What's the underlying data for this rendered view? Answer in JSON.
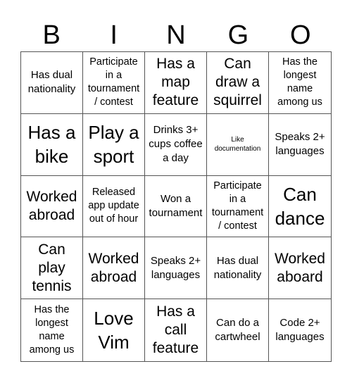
{
  "header": {
    "letters": [
      "B",
      "I",
      "N",
      "G",
      "O"
    ]
  },
  "board": {
    "cells": [
      {
        "text": "Has dual nationality",
        "size": "m"
      },
      {
        "text": "Participate in a tournament / contest",
        "size": "sm"
      },
      {
        "text": "Has a map feature",
        "size": "l"
      },
      {
        "text": "Can draw a squirrel",
        "size": "l"
      },
      {
        "text": "Has the longest name among us",
        "size": "sm"
      },
      {
        "text": "Has a bike",
        "size": "xl"
      },
      {
        "text": "Play a sport",
        "size": "xl"
      },
      {
        "text": "Drinks 3+ cups coffee a day",
        "size": "m"
      },
      {
        "text": "Like documentation",
        "size": "xs"
      },
      {
        "text": "Speaks 2+ languages",
        "size": "m"
      },
      {
        "text": "Worked abroad",
        "size": "l"
      },
      {
        "text": "Released app update out of hour",
        "size": "sm"
      },
      {
        "text": "Won a tournament",
        "size": "m"
      },
      {
        "text": "Participate in a tournament / contest",
        "size": "sm"
      },
      {
        "text": "Can dance",
        "size": "xl"
      },
      {
        "text": "Can play tennis",
        "size": "l"
      },
      {
        "text": "Worked abroad",
        "size": "l"
      },
      {
        "text": "Speaks 2+ languages",
        "size": "m"
      },
      {
        "text": "Has dual nationality",
        "size": "m"
      },
      {
        "text": "Worked aboard",
        "size": "l"
      },
      {
        "text": "Has the longest name among us",
        "size": "sm"
      },
      {
        "text": "Love Vim",
        "size": "xl"
      },
      {
        "text": "Has a call feature",
        "size": "l"
      },
      {
        "text": "Can do a cartwheel",
        "size": "m"
      },
      {
        "text": "Code 2+ languages",
        "size": "m"
      }
    ]
  }
}
